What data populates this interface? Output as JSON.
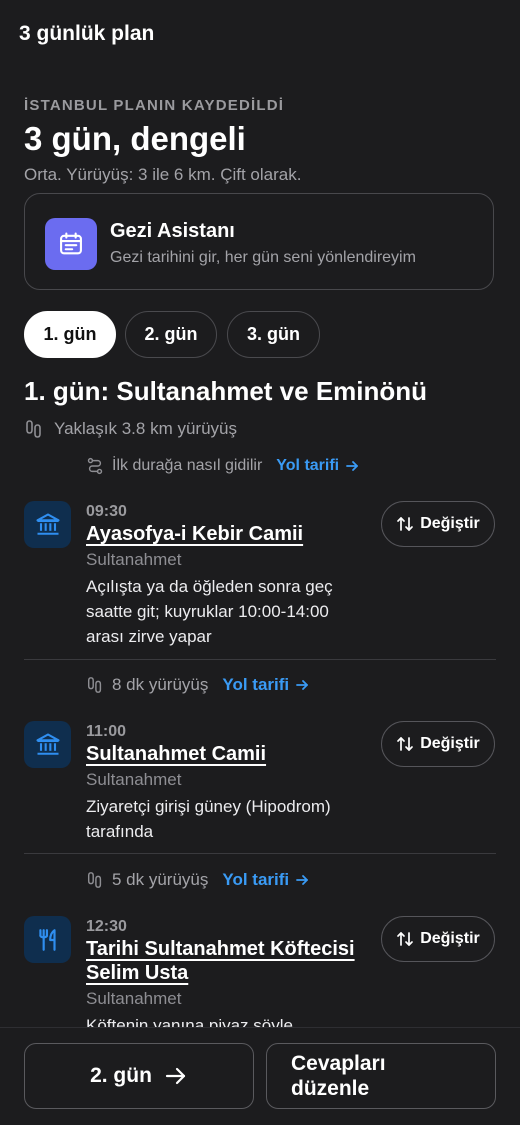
{
  "topbar": {
    "title": "3 günlük plan"
  },
  "header": {
    "eyebrow": "İSTANBUL PLANIN KAYDEDİLDİ",
    "title": "3 gün, dengeli",
    "subtitle": "Orta. Yürüyüş: 3 ile 6 km. Çift olarak."
  },
  "assistant": {
    "icon": "calendar-icon",
    "title": "Gezi Asistanı",
    "subtitle": "Gezi tarihini gir, her gün seni yönlendireyim"
  },
  "tabs": [
    {
      "label": "1. gün",
      "active": true
    },
    {
      "label": "2. gün",
      "active": false
    },
    {
      "label": "3. gün",
      "active": false
    }
  ],
  "day": {
    "title": "1. gün: Sultanahmet ve Eminönü",
    "walk_total": "Yaklaşık 3.8 km yürüyüş",
    "first_route": {
      "text": "İlk durağa nasıl gidilir",
      "link": "Yol tarifi"
    }
  },
  "stops": [
    {
      "icon": "museum-icon",
      "time": "09:30",
      "name": "Ayasofya-i Kebir Camii",
      "area": "Sultanahmet",
      "note": "Açılışta ya da öğleden sonra geç saatte git; kuyruklar 10:00-14:00 arası zirve yapar",
      "change_label": "Değiştir"
    },
    {
      "icon": "museum-icon",
      "time": "11:00",
      "name": "Sultanahmet Camii",
      "area": "Sultanahmet",
      "note": "Ziyaretçi girişi güney (Hipodrom) tarafında",
      "change_label": "Değiştir"
    },
    {
      "icon": "restaurant-icon",
      "time": "12:30",
      "name": "Tarihi Sultanahmet Köftecisi Selim Usta",
      "area": "Sultanahmet",
      "note": "Köftenin yanına piyaz söyle",
      "change_label": "Değiştir"
    }
  ],
  "walks": [
    {
      "text": "8 dk yürüyüş",
      "link": "Yol tarifi"
    },
    {
      "text": "5 dk yürüyüş",
      "link": "Yol tarifi"
    }
  ],
  "bottom": {
    "next_label": "2. gün",
    "edit_label": "Cevapları düzenle"
  },
  "colors": {
    "background": "#1c1c1e",
    "accent_link": "#3a9bf5",
    "assistant_badge": "#6b6cf0",
    "stop_icon_bg": "#0f2e4e",
    "stop_icon": "#2f8ef0"
  }
}
